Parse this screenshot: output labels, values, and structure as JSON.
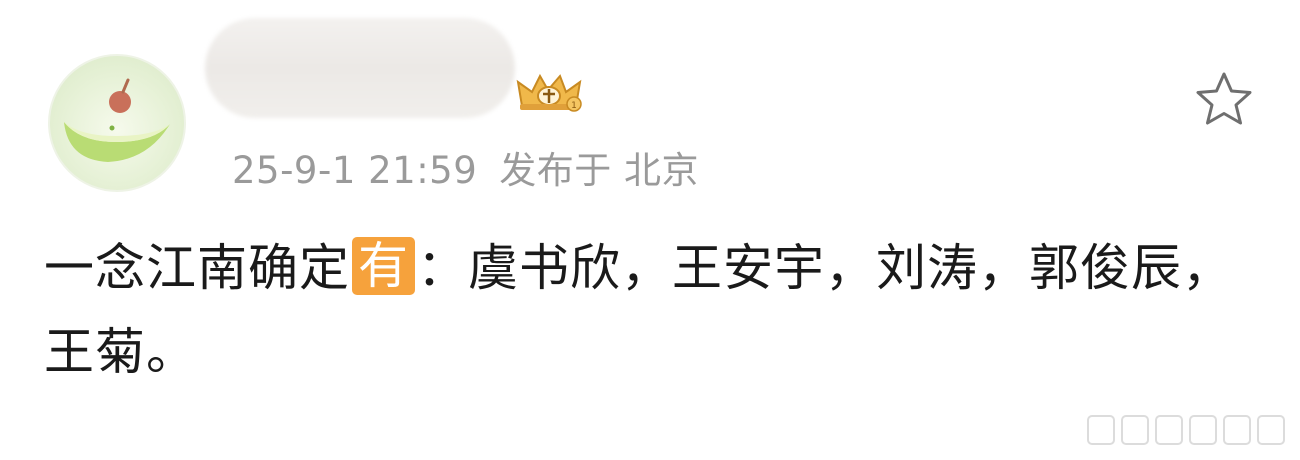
{
  "post": {
    "timestamp": "25-9-1 21:59",
    "location": "发布于 北京",
    "content_before": "一念江南确定",
    "content_highlight": "有",
    "content_after": "：虞书欣，王安宇，刘涛，郭俊辰，王菊。"
  },
  "icons": {
    "avatar": "melon-avatar",
    "badge": "crown-badge-icon",
    "favorite": "star-outline-icon",
    "watermark": "watermark-icon"
  },
  "colors": {
    "highlight_bg": "#f6a23c",
    "meta_text": "#9a9a9a",
    "body_text": "#1a1a1a"
  }
}
